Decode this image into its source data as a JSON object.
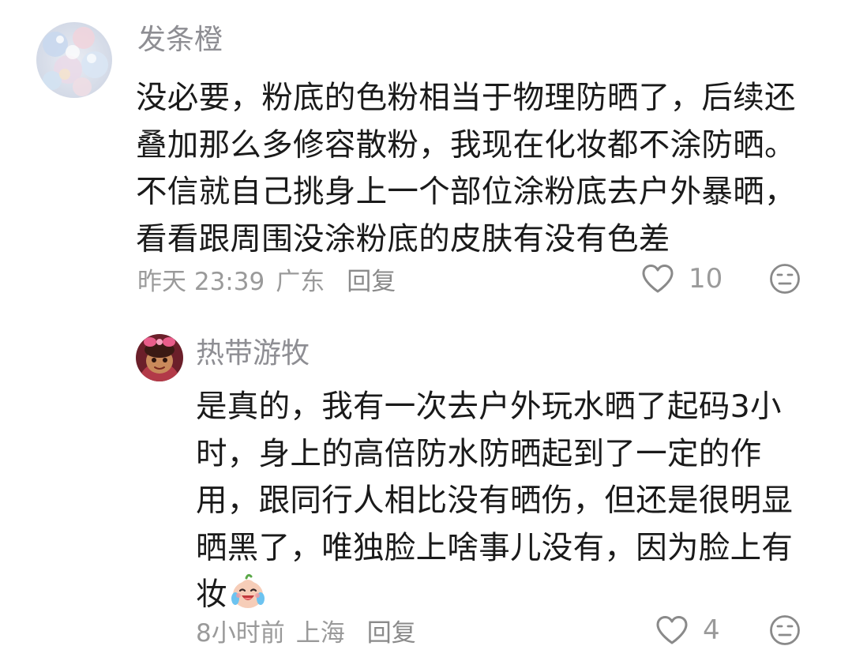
{
  "comments": [
    {
      "username": "发条橙",
      "text": "没必要，粉底的色粉相当于物理防晒了，后续还叠加那么多修容散粉，我现在化妆都不涂防晒。不信就自己挑身上一个部位涂粉底去户外暴晒，看看跟周围没涂粉底的皮肤有没有色差",
      "time": "昨天 23:39",
      "location": "广东",
      "reply_label": "回复",
      "like_count": "10",
      "avatar_icon": "pastel-bubbles-avatar"
    },
    {
      "username": "热带游牧",
      "text": "是真的，我有一次去户外玩水晒了起码3小时，身上的高倍防水防晒起到了一定的作用，跟同行人相比没有晒伤，但还是很明显晒黑了，唯独脸上啥事儿没有，因为脸上有妆",
      "emoji": "crying-laughing-emoji",
      "time": "8小时前",
      "location": "上海",
      "reply_label": "回复",
      "like_count": "4",
      "avatar_icon": "cartoon-character-avatar"
    }
  ],
  "icons": {
    "like": "heart-outline-icon",
    "dislike": "neutral-face-icon"
  },
  "colors": {
    "text": "#1a1a1a",
    "muted": "#9a9a9a",
    "username": "#8e8e93"
  }
}
